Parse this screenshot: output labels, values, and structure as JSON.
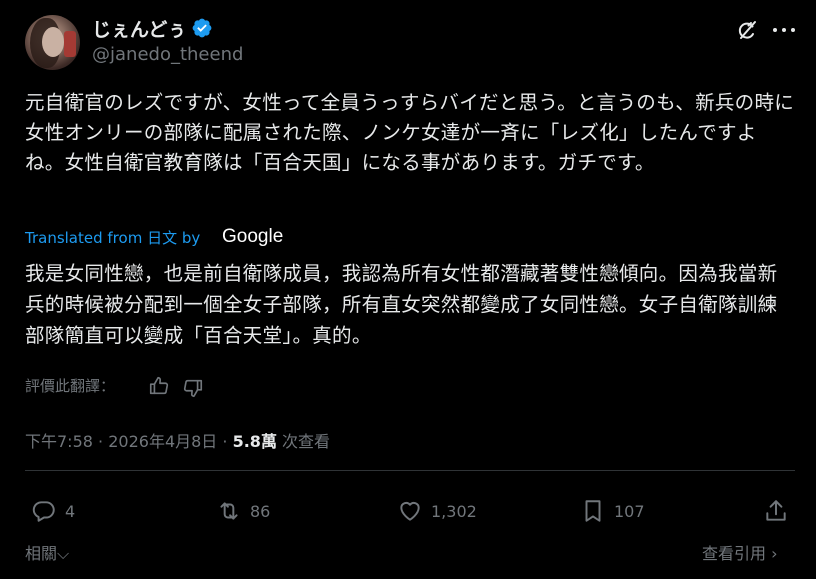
{
  "author": {
    "name": "じぇんどぅ",
    "handle": "@janedo_theend"
  },
  "post": {
    "original_text": "元自衛官のレズですが、女性って全員うっすらバイだと思う。と言うのも、新兵の時に女性オンリーの部隊に配属された際、ノンケ女達が一斉に「レズ化」したんですよね。女性自衛官教育隊は「百合天国」になる事があります。ガチです。",
    "translated_from": "Translated from 日文 by",
    "translator": "Google",
    "translated_text": "我是女同性戀，也是前自衛隊成員，我認為所有女性都潛藏著雙性戀傾向。因為我當新兵的時候被分配到一個全女子部隊，所有直女突然都變成了女同性戀。女子自衛隊訓練部隊簡直可以變成「百合天堂」。真的。",
    "rate_translation": "評價此翻譯：",
    "time": "下午7:58",
    "date": "2026年4月8日",
    "views_count": "5.8萬",
    "views_label": "次查看",
    "sep": "·"
  },
  "actions": {
    "replies": "4",
    "reposts": "86",
    "likes": "1,302",
    "bookmarks": "107"
  },
  "footer": {
    "related": "相關",
    "view_quotes": "查看引用"
  },
  "colors": {
    "background": "#000000",
    "text": "#e7e9ea",
    "muted": "#71767b",
    "link": "#1d9bf0",
    "verified": "#1d9bf0"
  }
}
